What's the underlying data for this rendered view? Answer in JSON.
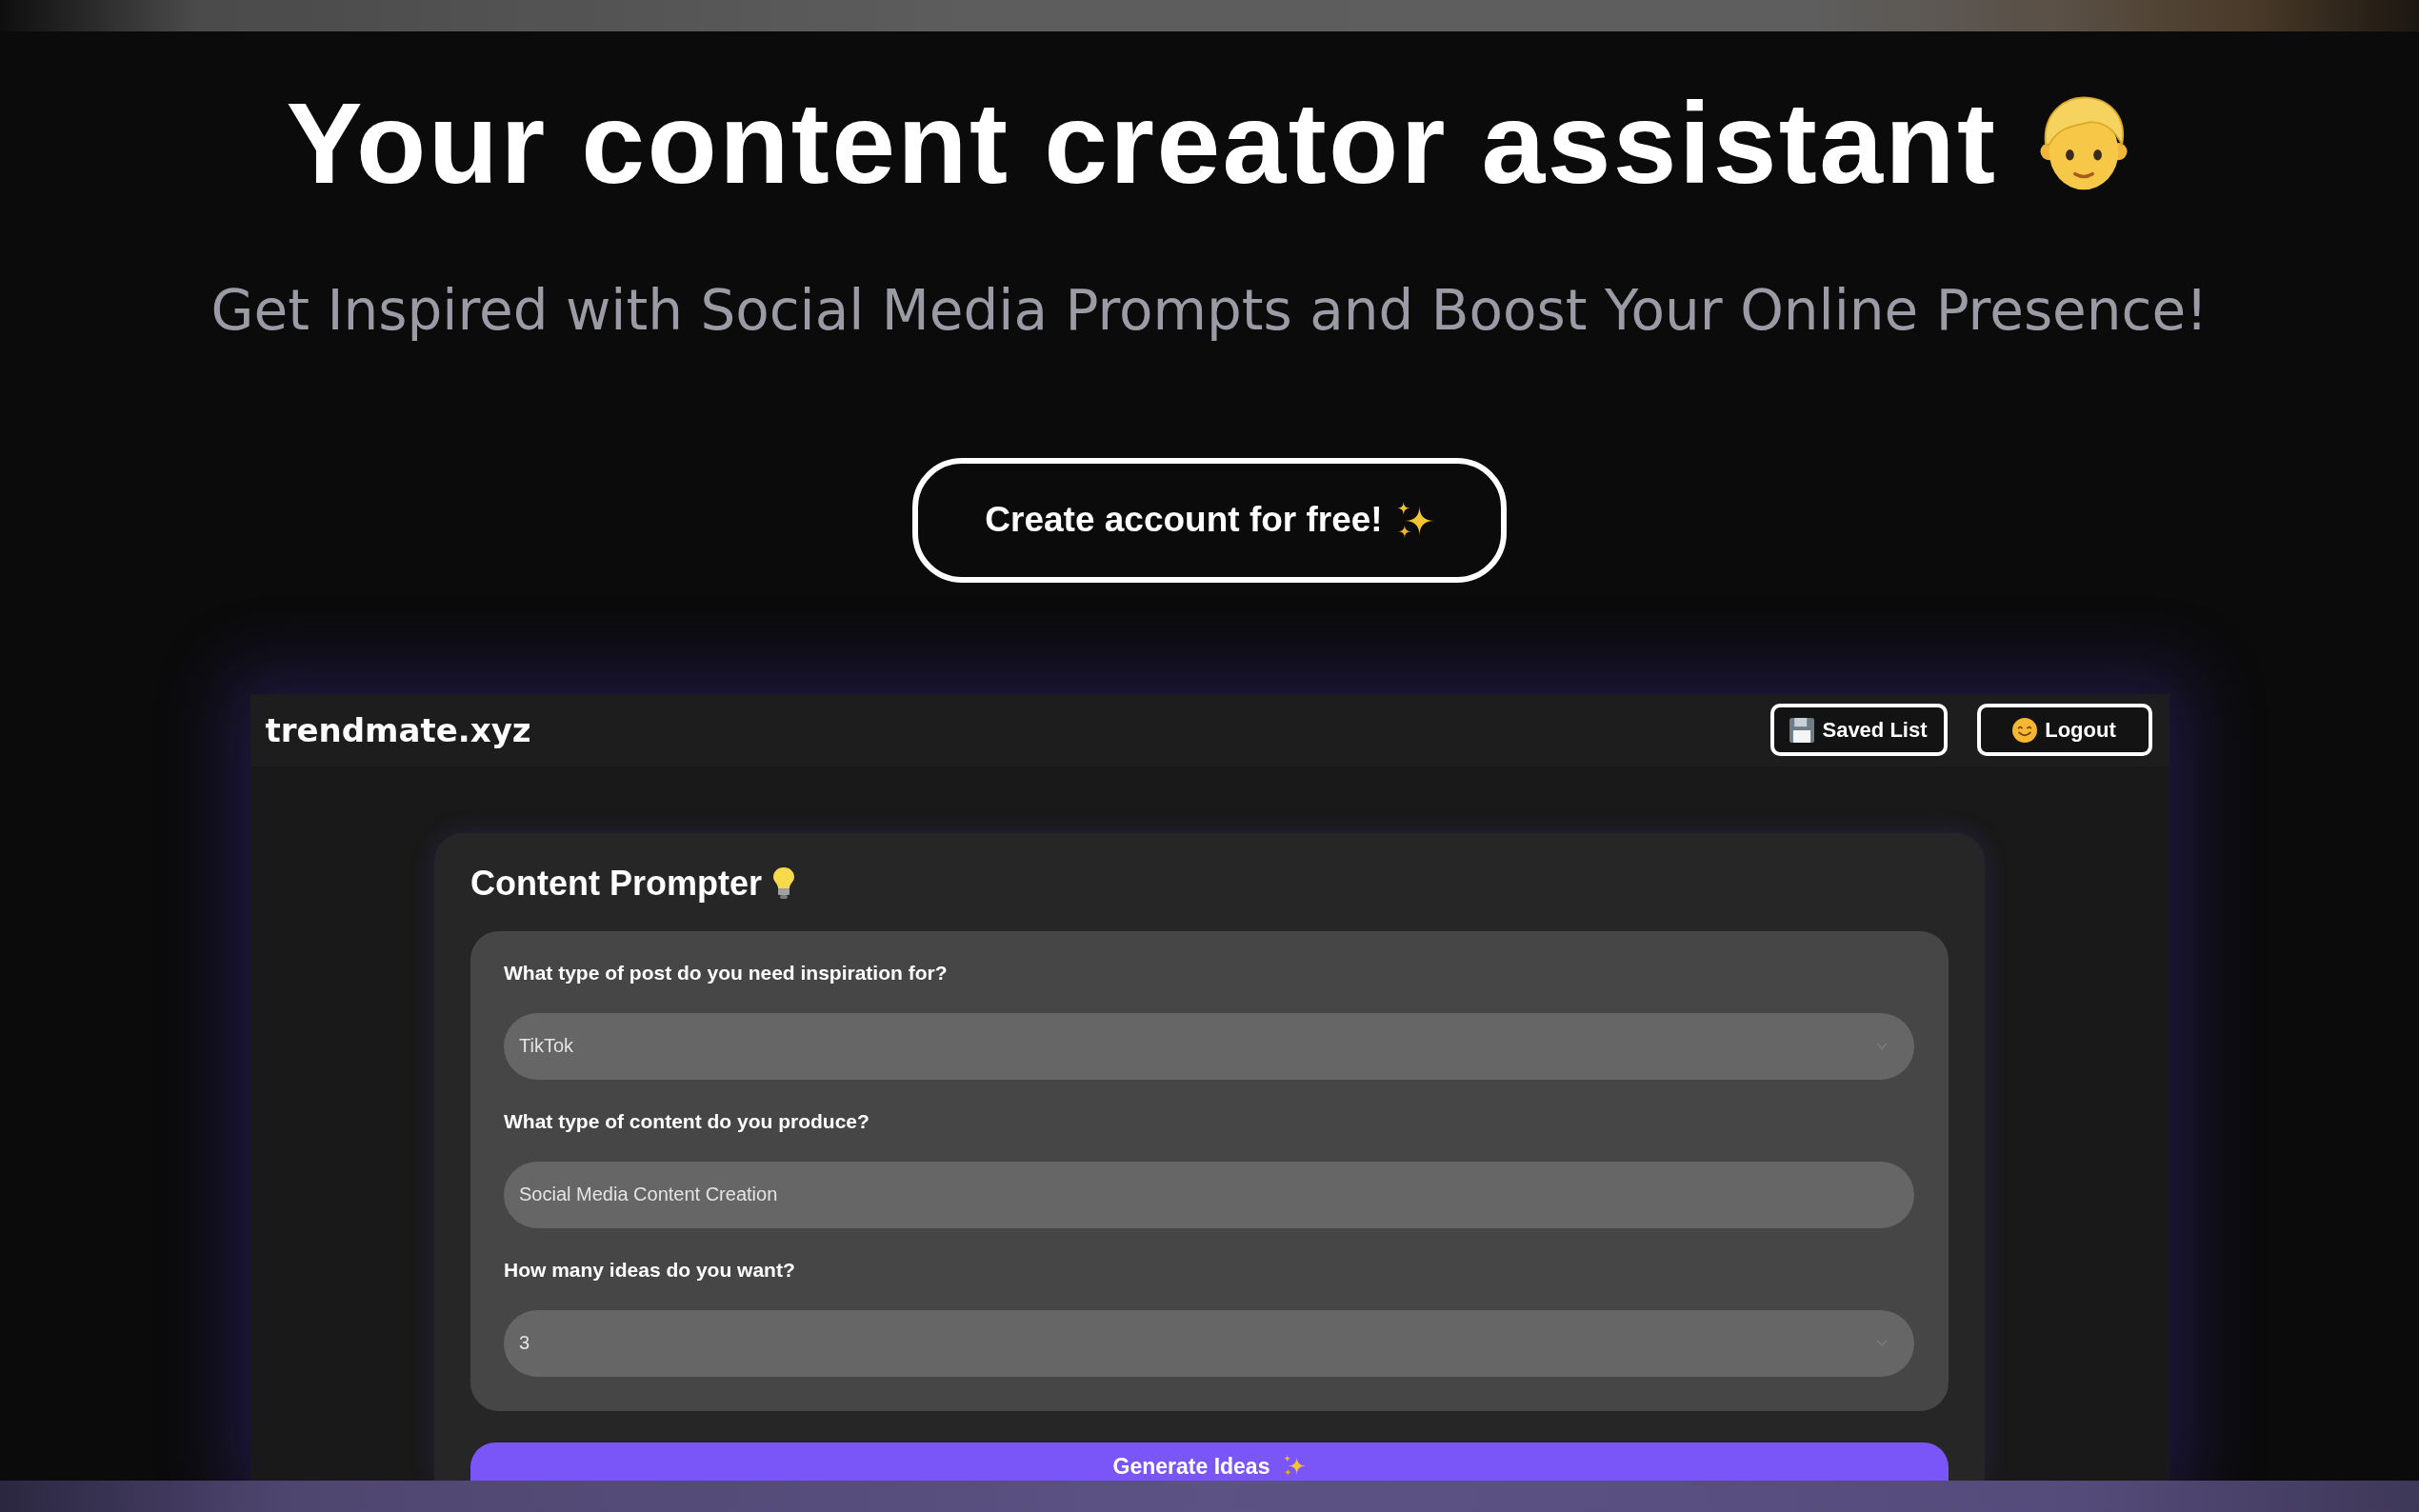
{
  "hero": {
    "title": "Your content creator assistant",
    "subtitle": "Get Inspired with Social Media Prompts and Boost Your Online Presence!",
    "cta_button": "Create account for free!"
  },
  "app_preview": {
    "header": {
      "logo": "trendmate.xyz",
      "saved_list_button": "Saved List",
      "logout_button": "Logout"
    },
    "form": {
      "title": "Content Prompter",
      "fields": [
        {
          "kind": "select",
          "label": "What type of post do you need inspiration for?",
          "value": "TikTok"
        },
        {
          "kind": "text",
          "label": "What type of content do you produce?",
          "value": "Social Media Content Creation"
        },
        {
          "kind": "select",
          "label": "How many ideas do you want?",
          "value": "3"
        }
      ],
      "submit_button": "Generate Ideas"
    }
  }
}
